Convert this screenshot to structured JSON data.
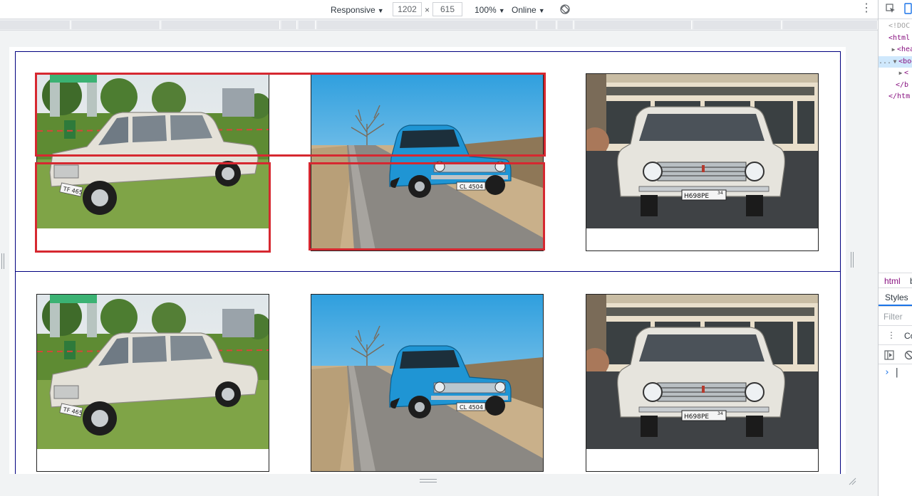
{
  "toolbar": {
    "device": "Responsive",
    "width": "1202",
    "times": "×",
    "height": "615",
    "zoom": "100%",
    "throttle": "Online",
    "more_icon": "vertical-dots-icon",
    "rotate_icon": "rotate-icon"
  },
  "devtools": {
    "lines": [
      "<!DOC",
      "<html",
      "<hea",
      "<bod",
      "<",
      "</b",
      "</htm"
    ],
    "breadcrumb_item": "html",
    "breadcrumb_next": "b",
    "styles_tab": "Styles",
    "filter_placeholder": "Filter",
    "console_tab": "Co",
    "prompt": "›",
    "ellipsis": "..."
  },
  "page": {
    "rows": [
      {
        "cards": [
          {
            "image": "white sedan on grass",
            "plate": "ТF 465"
          },
          {
            "image": "blue sedan on road",
            "plate": "CL 4504"
          },
          {
            "image": "white sedan front view",
            "plate": "Н698РЕ"
          }
        ]
      },
      {
        "cards": [
          {
            "image": "white sedan on grass",
            "plate": "ТF 465"
          },
          {
            "image": "blue sedan on road",
            "plate": "CL 4504"
          },
          {
            "image": "white sedan front view",
            "plate": "Н698РЕ"
          }
        ]
      }
    ],
    "region_34": "34"
  },
  "colors": {
    "highlight": "#d62830",
    "row_border": "#00007f",
    "car_blue": "#1e9ad6",
    "car_white": "#e8e6df"
  }
}
